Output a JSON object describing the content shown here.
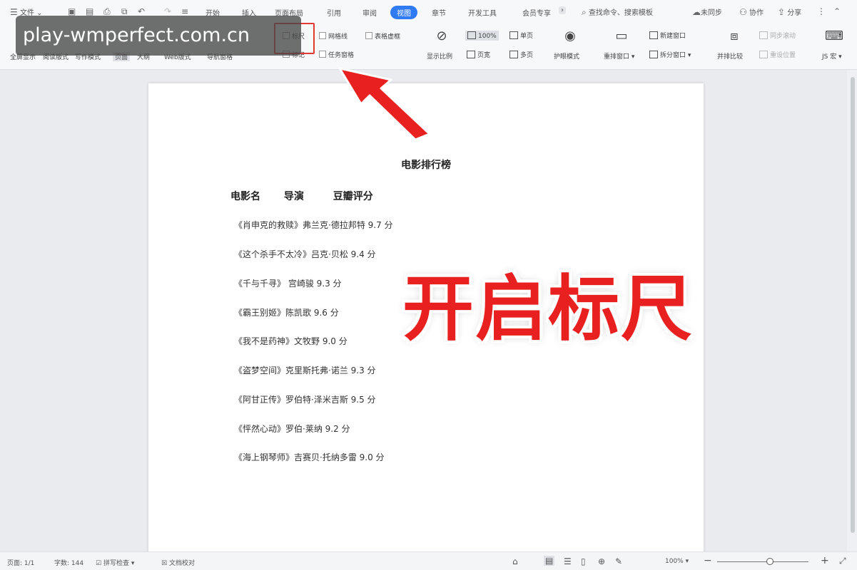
{
  "titlebar": {
    "menu_label": "文件",
    "tabs": [
      {
        "label": "开始",
        "active": false
      },
      {
        "label": "插入",
        "active": false
      },
      {
        "label": "页面布局",
        "active": false
      },
      {
        "label": "引用",
        "active": false
      },
      {
        "label": "审阅",
        "active": false
      },
      {
        "label": "视图",
        "active": true
      },
      {
        "label": "章节",
        "active": false
      },
      {
        "label": "开发工具",
        "active": false
      },
      {
        "label": "会员专享",
        "active": false
      }
    ],
    "search_placeholder": "查找命令、搜索模板",
    "sync_label": "未同步",
    "collab_label": "协作",
    "share_label": "分享"
  },
  "ribbon": {
    "row2_labels": [
      "全屏显示",
      "阅读版式",
      "写作模式",
      "页面",
      "大纲",
      "Web版式",
      "导航窗格"
    ],
    "ruler_label": "标尺",
    "gridlines_label": "网格线",
    "markup_label": "表格虚框",
    "mark_label": "标记",
    "taskpane_label": "任务窗格",
    "zoom_ratio_label": "显示比例",
    "zoom_100_label": "100%",
    "single_page_label": "单页",
    "page_width_label": "页宽",
    "multi_page_label": "多页",
    "eye_mode_label": "护眼模式",
    "rearrange_label": "重排窗口",
    "new_window_label": "新建窗口",
    "split_window_label": "拆分窗口",
    "side_by_side_label": "并排比较",
    "sync_scroll_label": "同步滚动",
    "reset_position_label": "重设位置",
    "js_label": "JS 宏"
  },
  "watermark": "play-wmperfect.com.cn",
  "document": {
    "title": "电影排行榜",
    "headers": [
      "电影名",
      "导演",
      "豆瓣评分"
    ],
    "rows": [
      "《肖申克的救赎》弗兰克·德拉邦特 9.7 分",
      "《这个杀手不太冷》吕克·贝松 9.4 分",
      "《千与千寻》 宫崎骏 9.3 分",
      "《霸王别姬》陈凯歌 9.6 分",
      "《我不是药神》文牧野 9.0 分",
      "《盗梦空间》克里斯托弗·诺兰 9.3 分",
      "《阿甘正传》罗伯特·泽米吉斯 9.5 分",
      "《怦然心动》罗伯·莱纳 9.2 分",
      "《海上钢琴师》吉赛贝·托纳多雷 9.0 分"
    ]
  },
  "overlay_caption": "开启标尺",
  "statusbar": {
    "page_label": "页面: 1/1",
    "wordcount_label": "字数: 144",
    "spellcheck_label": "拼写检查",
    "doc_check_label": "文档校对",
    "zoom_value": "100%",
    "zoom_fraction": 0.5
  },
  "colors": {
    "accent": "#2f7bf5",
    "caption_red": "#e8201f",
    "highlight_red": "#e23a36"
  }
}
